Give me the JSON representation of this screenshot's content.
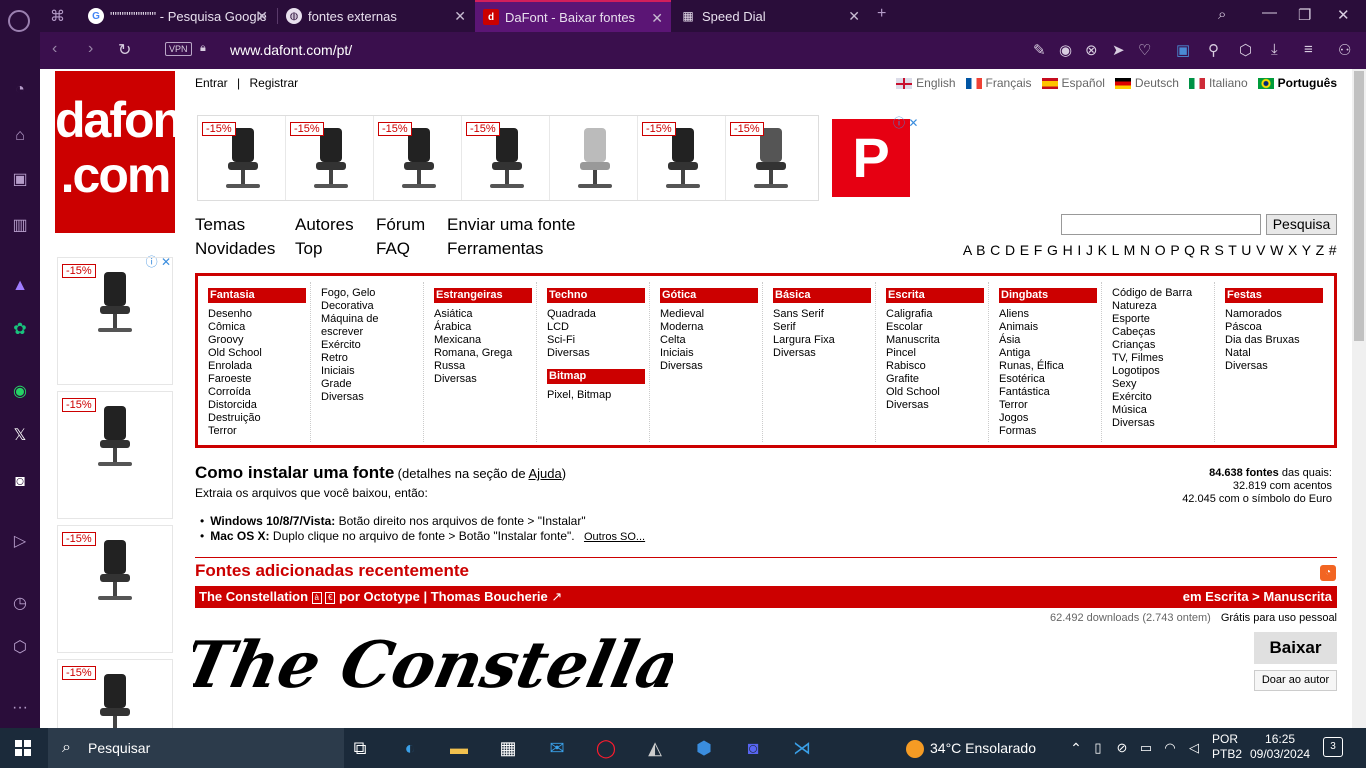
{
  "tabs": [
    {
      "label": "\"\"\"\"\"\"\"\"\"\" - Pesquisa Google"
    },
    {
      "label": "fontes externas"
    },
    {
      "label": "DaFont - Baixar fontes"
    },
    {
      "label": "Speed Dial"
    }
  ],
  "address": {
    "vpn": "VPN",
    "url": "www.dafont.com/pt/"
  },
  "site": {
    "logo_line1": "dafont",
    "logo_line2": ".com",
    "login": "Entrar",
    "register": "Registrar",
    "login_sep": "|",
    "languages": [
      "English",
      "Français",
      "Español",
      "Deutsch",
      "Italiano",
      "Português"
    ],
    "ad_discount": "-15%",
    "nav": [
      "Temas",
      "Autores",
      "Fórum",
      "Enviar uma fonte",
      "Novidades",
      "Top",
      "FAQ",
      "Ferramentas"
    ],
    "search_button": "Pesquisa",
    "alphabet": "A B C D E F G H I J K L M N O P Q R S T U V W X Y Z #"
  },
  "categories": [
    {
      "title": "Fantasia",
      "items": [
        "Desenho",
        "Cômica",
        "Groovy",
        "Old School",
        "Enrolada",
        "Faroeste",
        "Corroída",
        "Distorcida",
        "Destruição",
        "Terror"
      ]
    },
    {
      "title": "",
      "items": [
        "Fogo, Gelo",
        "Decorativa",
        "Máquina de",
        "escrever",
        "Exército",
        "Retro",
        "Iniciais",
        "Grade",
        "Diversas"
      ]
    },
    {
      "title": "Estrangeiras",
      "items": [
        "Asiática",
        "Árabica",
        "Mexicana",
        "Romana, Grega",
        "Russa",
        "Diversas"
      ]
    },
    {
      "title": "Techno",
      "items": [
        "Quadrada",
        "LCD",
        "Sci-Fi",
        "Diversas"
      ],
      "title2": "Bitmap",
      "items2": [
        "Pixel, Bitmap"
      ]
    },
    {
      "title": "Gótica",
      "items": [
        "Medieval",
        "Moderna",
        "Celta",
        "Iniciais",
        "Diversas"
      ]
    },
    {
      "title": "Básica",
      "items": [
        "Sans Serif",
        "Serif",
        "Largura Fixa",
        "Diversas"
      ]
    },
    {
      "title": "Escrita",
      "items": [
        "Caligrafia",
        "Escolar",
        "Manuscrita",
        "Pincel",
        "Rabisco",
        "Grafite",
        "Old School",
        "Diversas"
      ]
    },
    {
      "title": "Dingbats",
      "items": [
        "Aliens",
        "Animais",
        "Ásia",
        "Antiga",
        "Runas, Élfica",
        "Esotérica",
        "Fantástica",
        "Terror",
        "Jogos",
        "Formas"
      ]
    },
    {
      "title": "",
      "items": [
        "Código de Barra",
        "Natureza",
        "Esporte",
        "Cabeças",
        "Crianças",
        "TV, Filmes",
        "Logotipos",
        "Sexy",
        "Exército",
        "Música",
        "Diversas"
      ]
    },
    {
      "title": "Festas",
      "items": [
        "Namorados",
        "Páscoa",
        "Dia das Bruxas",
        "Natal",
        "Diversas"
      ]
    }
  ],
  "install": {
    "title": "Como instalar uma fonte",
    "sub_prefix": "(detalhes na seção de ",
    "sub_link": "Ajuda",
    "sub_suffix": ")",
    "line2": "Extraia os arquivos que você baixou, então:",
    "win_label": "Windows 10/8/7/Vista:",
    "win_text": "Botão direito nos arquivos de fonte > \"Instalar\"",
    "mac_label": "Mac OS X:",
    "mac_text": "Duplo clique no arquivo de fonte > Botão \"Instalar fonte\".",
    "other_link": "Outros SO..."
  },
  "stats": {
    "total": "84.638 fontes",
    "total_suffix": "das quais:",
    "accents": "32.819 com acentos",
    "euro": "42.045 com o símbolo do Euro"
  },
  "recent": {
    "heading": "Fontes adicionadas recentemente",
    "font_name": "The Constellation",
    "glyph1": "à",
    "glyph2": "€",
    "by": "por Octotype | Thomas Boucherie",
    "category": "em Escrita > Manuscrita",
    "downloads": "62.492 downloads (2.743 ontem)",
    "license": "Grátis para uso pessoal",
    "preview_text": "The Constellation",
    "download_button": "Baixar",
    "donate_button": "Doar ao autor"
  },
  "taskbar": {
    "search": "Pesquisar",
    "weather": "34°C  Ensolarado",
    "lang_line1": "POR",
    "lang_line2": "PTB2",
    "time": "16:25",
    "date": "09/03/2024",
    "notifications": "3"
  },
  "colors": {
    "brand": "#cc0000",
    "browser_bg": "#2a0d3a",
    "active_tab": "#5b1575"
  }
}
